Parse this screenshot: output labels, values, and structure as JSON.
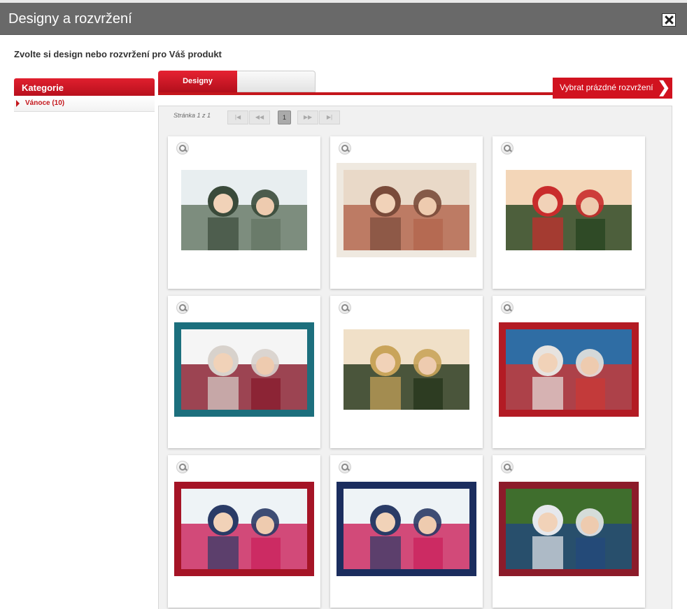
{
  "dialog": {
    "title": "Designy a rozvržení",
    "subtitle": "Zvolte si design nebo rozvržení pro Váš produkt"
  },
  "sidebar": {
    "header": "Kategorie",
    "items": [
      {
        "label": "Vánoce (10)"
      }
    ]
  },
  "tabs": [
    {
      "label": "Designy",
      "active": true
    },
    {
      "label": "",
      "active": false
    }
  ],
  "blank_layout_button": "Vybrat prázdné rozvržení",
  "pager": {
    "text": "Stránka 1 z 1",
    "first": "|◀",
    "prev": "◀◀",
    "current": "1",
    "next": "▶▶",
    "last": "▶|"
  },
  "designs": [
    {
      "name": "snowy-frame-woman",
      "border": "#ffffff",
      "palette": [
        "#6a7b6a",
        "#3a4a3a",
        "#e8eef0"
      ]
    },
    {
      "name": "couple-winter-frame",
      "border": "#efe9e0",
      "palette": [
        "#b56a52",
        "#7a4b3a",
        "#e9d9c8"
      ]
    },
    {
      "name": "christmas-kids",
      "border": "#ffffff",
      "palette": [
        "#2f4a26",
        "#c92c2c",
        "#f3d6b8"
      ]
    },
    {
      "name": "woman-earmuffs-teal",
      "border": "#1c6f7d",
      "palette": [
        "#8c2435",
        "#d8d2cc",
        "#f5f5f5"
      ]
    },
    {
      "name": "girl-tree-deer",
      "border": "#ffffff",
      "palette": [
        "#2d3c22",
        "#c9a45a",
        "#f0e0c8"
      ]
    },
    {
      "name": "family-collage-red",
      "border": "#b31b24",
      "palette": [
        "#c33a3a",
        "#e7e3df",
        "#2f6da4"
      ]
    },
    {
      "name": "father-daughter-red",
      "border": "#a51426",
      "palette": [
        "#cc2b63",
        "#2a3b66",
        "#eef3f6"
      ]
    },
    {
      "name": "father-daughter-blue",
      "border": "#1b2d5e",
      "palette": [
        "#cc2b63",
        "#2a3b66",
        "#eef3f6"
      ]
    },
    {
      "name": "couple-patchwork",
      "border": "#8c1b2a",
      "palette": [
        "#244a78",
        "#e6e8ec",
        "#3f6e2d"
      ]
    }
  ]
}
